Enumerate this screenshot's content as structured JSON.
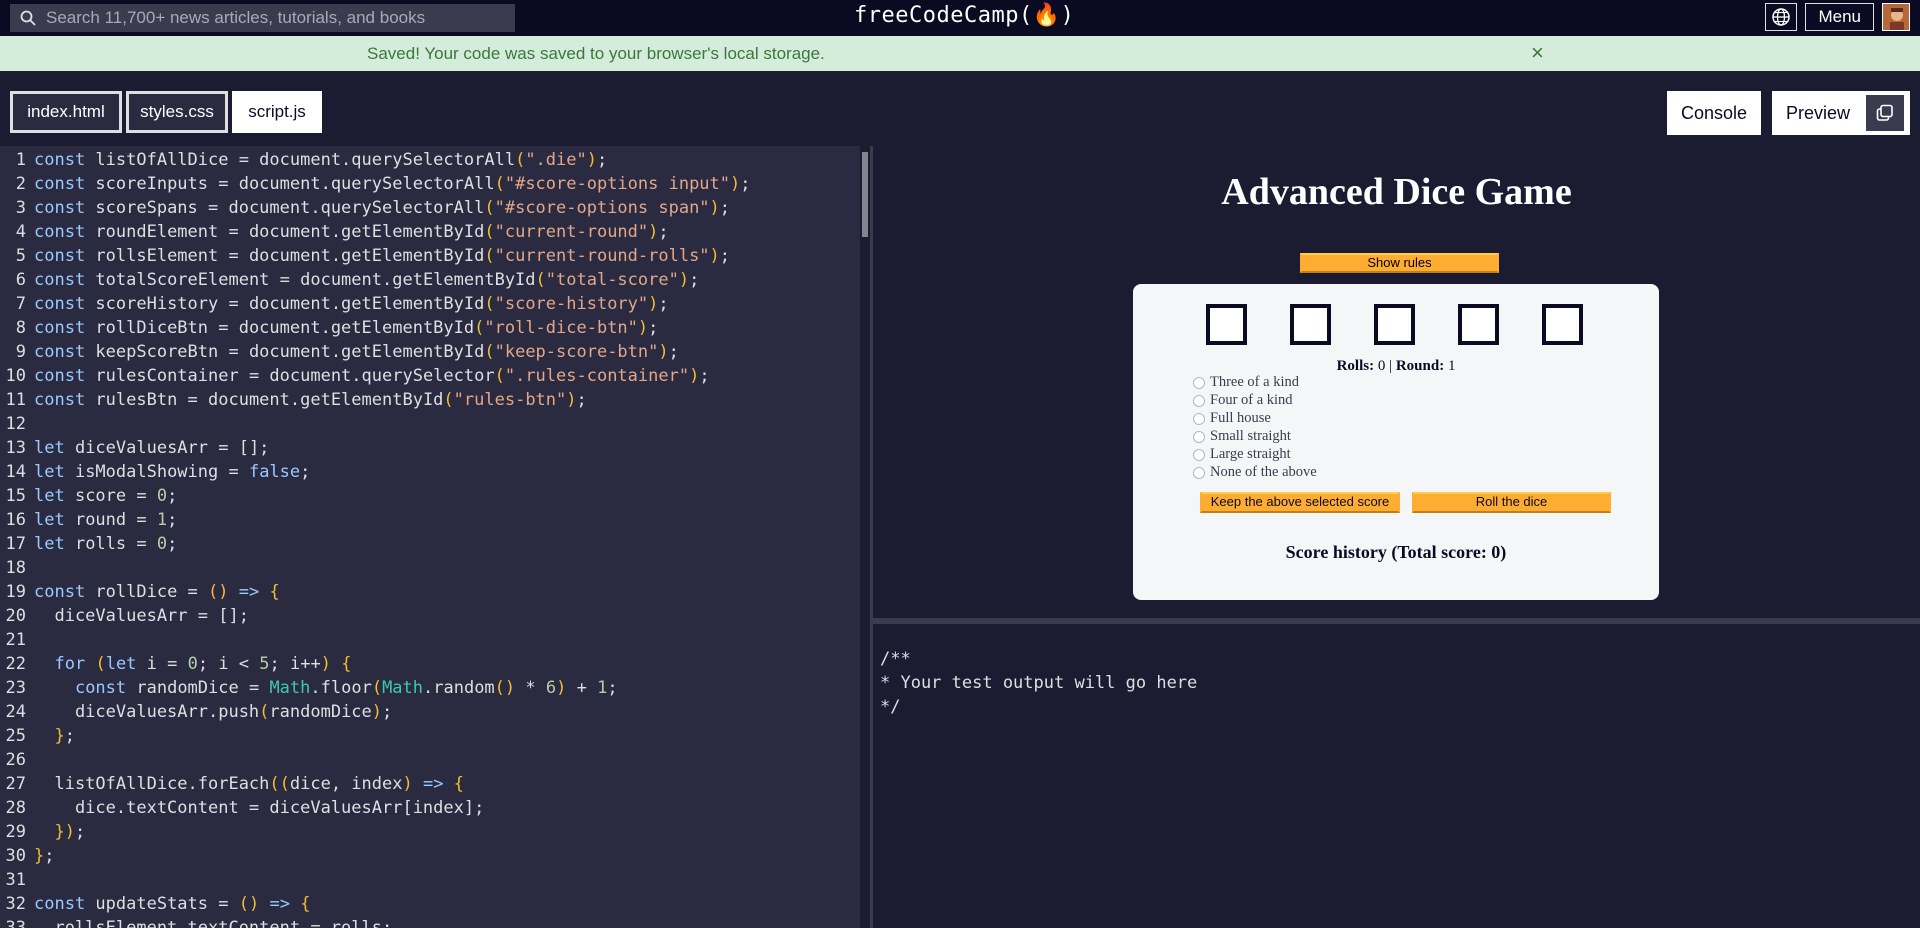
{
  "nav": {
    "search_placeholder": "Search 11,700+ news articles, tutorials, and books",
    "brand": "freeCodeCamp(🔥)",
    "menu_label": "Menu",
    "icons": [
      "search-icon",
      "globe-icon",
      "avatar"
    ]
  },
  "flash": {
    "message": "Saved! Your code was saved to your browser's local storage.",
    "close": "×"
  },
  "tabs": [
    {
      "label": "index.html",
      "active": false
    },
    {
      "label": "styles.css",
      "active": false
    },
    {
      "label": "script.js",
      "active": true
    }
  ],
  "panel_buttons": {
    "console": "Console",
    "preview": "Preview"
  },
  "editor": {
    "language": "javascript",
    "lines": [
      [
        [
          "kw",
          "const"
        ],
        [
          "id",
          " listOfAllDice = document.querySelectorAll"
        ],
        [
          "br",
          "("
        ],
        [
          "str",
          "\".die\""
        ],
        [
          "br",
          ")"
        ],
        [
          "id",
          ";"
        ]
      ],
      [
        [
          "kw",
          "const"
        ],
        [
          "id",
          " scoreInputs = document.querySelectorAll"
        ],
        [
          "br",
          "("
        ],
        [
          "str",
          "\"#score-options input\""
        ],
        [
          "br",
          ")"
        ],
        [
          "id",
          ";"
        ]
      ],
      [
        [
          "kw",
          "const"
        ],
        [
          "id",
          " scoreSpans = document.querySelectorAll"
        ],
        [
          "br",
          "("
        ],
        [
          "str",
          "\"#score-options span\""
        ],
        [
          "br",
          ")"
        ],
        [
          "id",
          ";"
        ]
      ],
      [
        [
          "kw",
          "const"
        ],
        [
          "id",
          " roundElement = document.getElementById"
        ],
        [
          "br",
          "("
        ],
        [
          "str",
          "\"current-round\""
        ],
        [
          "br",
          ")"
        ],
        [
          "id",
          ";"
        ]
      ],
      [
        [
          "kw",
          "const"
        ],
        [
          "id",
          " rollsElement = document.getElementById"
        ],
        [
          "br",
          "("
        ],
        [
          "str",
          "\"current-round-rolls\""
        ],
        [
          "br",
          ")"
        ],
        [
          "id",
          ";"
        ]
      ],
      [
        [
          "kw",
          "const"
        ],
        [
          "id",
          " totalScoreElement = document.getElementById"
        ],
        [
          "br",
          "("
        ],
        [
          "str",
          "\"total-score\""
        ],
        [
          "br",
          ")"
        ],
        [
          "id",
          ";"
        ]
      ],
      [
        [
          "kw",
          "const"
        ],
        [
          "id",
          " scoreHistory = document.getElementById"
        ],
        [
          "br",
          "("
        ],
        [
          "str",
          "\"score-history\""
        ],
        [
          "br",
          ")"
        ],
        [
          "id",
          ";"
        ]
      ],
      [
        [
          "kw",
          "const"
        ],
        [
          "id",
          " rollDiceBtn = document.getElementById"
        ],
        [
          "br",
          "("
        ],
        [
          "str",
          "\"roll-dice-btn\""
        ],
        [
          "br",
          ")"
        ],
        [
          "id",
          ";"
        ]
      ],
      [
        [
          "kw",
          "const"
        ],
        [
          "id",
          " keepScoreBtn = document.getElementById"
        ],
        [
          "br",
          "("
        ],
        [
          "str",
          "\"keep-score-btn\""
        ],
        [
          "br",
          ")"
        ],
        [
          "id",
          ";"
        ]
      ],
      [
        [
          "kw",
          "const"
        ],
        [
          "id",
          " rulesContainer = document.querySelector"
        ],
        [
          "br",
          "("
        ],
        [
          "str",
          "\".rules-container\""
        ],
        [
          "br",
          ")"
        ],
        [
          "id",
          ";"
        ]
      ],
      [
        [
          "kw",
          "const"
        ],
        [
          "id",
          " rulesBtn = document.getElementById"
        ],
        [
          "br",
          "("
        ],
        [
          "str",
          "\"rules-btn\""
        ],
        [
          "br",
          ")"
        ],
        [
          "id",
          ";"
        ]
      ],
      [],
      [
        [
          "kw",
          "let"
        ],
        [
          "id",
          " diceValuesArr = [];"
        ]
      ],
      [
        [
          "kw",
          "let"
        ],
        [
          "id",
          " isModalShowing = "
        ],
        [
          "kw",
          "false"
        ],
        [
          "id",
          ";"
        ]
      ],
      [
        [
          "kw",
          "let"
        ],
        [
          "id",
          " score = "
        ],
        [
          "num",
          "0"
        ],
        [
          "id",
          ";"
        ]
      ],
      [
        [
          "kw",
          "let"
        ],
        [
          "id",
          " round = "
        ],
        [
          "num",
          "1"
        ],
        [
          "id",
          ";"
        ]
      ],
      [
        [
          "kw",
          "let"
        ],
        [
          "id",
          " rolls = "
        ],
        [
          "num",
          "0"
        ],
        [
          "id",
          ";"
        ]
      ],
      [],
      [
        [
          "kw",
          "const"
        ],
        [
          "id",
          " rollDice = "
        ],
        [
          "br",
          "()"
        ],
        [
          "id",
          " "
        ],
        [
          "kw",
          "=>"
        ],
        [
          "id",
          " "
        ],
        [
          "br",
          "{"
        ]
      ],
      [
        [
          "id",
          "  diceValuesArr = [];"
        ]
      ],
      [],
      [
        [
          "id",
          "  "
        ],
        [
          "kw",
          "for"
        ],
        [
          "id",
          " "
        ],
        [
          "br",
          "("
        ],
        [
          "kw",
          "let"
        ],
        [
          "id",
          " i = "
        ],
        [
          "num",
          "0"
        ],
        [
          "id",
          "; i < "
        ],
        [
          "num",
          "5"
        ],
        [
          "id",
          "; i++"
        ],
        [
          "br",
          ")"
        ],
        [
          "id",
          " "
        ],
        [
          "br",
          "{"
        ]
      ],
      [
        [
          "id",
          "    "
        ],
        [
          "kw",
          "const"
        ],
        [
          "id",
          " randomDice = "
        ],
        [
          "cls",
          "Math"
        ],
        [
          "id",
          ".floor"
        ],
        [
          "br",
          "("
        ],
        [
          "cls",
          "Math"
        ],
        [
          "id",
          ".random"
        ],
        [
          "br",
          "()"
        ],
        [
          "id",
          " * "
        ],
        [
          "num",
          "6"
        ],
        [
          "br",
          ")"
        ],
        [
          "id",
          " + "
        ],
        [
          "num",
          "1"
        ],
        [
          "id",
          ";"
        ]
      ],
      [
        [
          "id",
          "    diceValuesArr.push"
        ],
        [
          "br",
          "("
        ],
        [
          "id",
          "randomDice"
        ],
        [
          "br",
          ")"
        ],
        [
          "id",
          ";"
        ]
      ],
      [
        [
          "id",
          "  "
        ],
        [
          "br",
          "}"
        ],
        [
          "id",
          ";"
        ]
      ],
      [],
      [
        [
          "id",
          "  listOfAllDice.forEach"
        ],
        [
          "br",
          "(("
        ],
        [
          "id",
          "dice, index"
        ],
        [
          "br",
          ")"
        ],
        [
          "id",
          " "
        ],
        [
          "kw",
          "=>"
        ],
        [
          "id",
          " "
        ],
        [
          "br",
          "{"
        ]
      ],
      [
        [
          "id",
          "    dice.textContent = diceValuesArr[index];"
        ]
      ],
      [
        [
          "id",
          "  "
        ],
        [
          "br",
          "})"
        ],
        [
          "id",
          ";"
        ]
      ],
      [
        [
          "br",
          "}"
        ],
        [
          "id",
          ";"
        ]
      ],
      [],
      [
        [
          "kw",
          "const"
        ],
        [
          "id",
          " updateStats = "
        ],
        [
          "br",
          "()"
        ],
        [
          "id",
          " "
        ],
        [
          "kw",
          "=>"
        ],
        [
          "id",
          " "
        ],
        [
          "br",
          "{"
        ]
      ],
      [
        [
          "id",
          "  rollsElement.textContent = rolls;"
        ]
      ]
    ]
  },
  "preview": {
    "title": "Advanced Dice Game",
    "show_rules": "Show rules",
    "rolls_label": "Rolls:",
    "rolls_value": "0",
    "separator": "|",
    "round_label": "Round:",
    "round_value": "1",
    "options": [
      "Three of a kind",
      "Four of a kind",
      "Full house",
      "Small straight",
      "Large straight",
      "None of the above"
    ],
    "keep_btn": "Keep the above selected score",
    "roll_btn": "Roll the dice",
    "history": "Score history (Total score: 0)"
  },
  "console_text": "/**\n* Your test output will go here\n*/"
}
